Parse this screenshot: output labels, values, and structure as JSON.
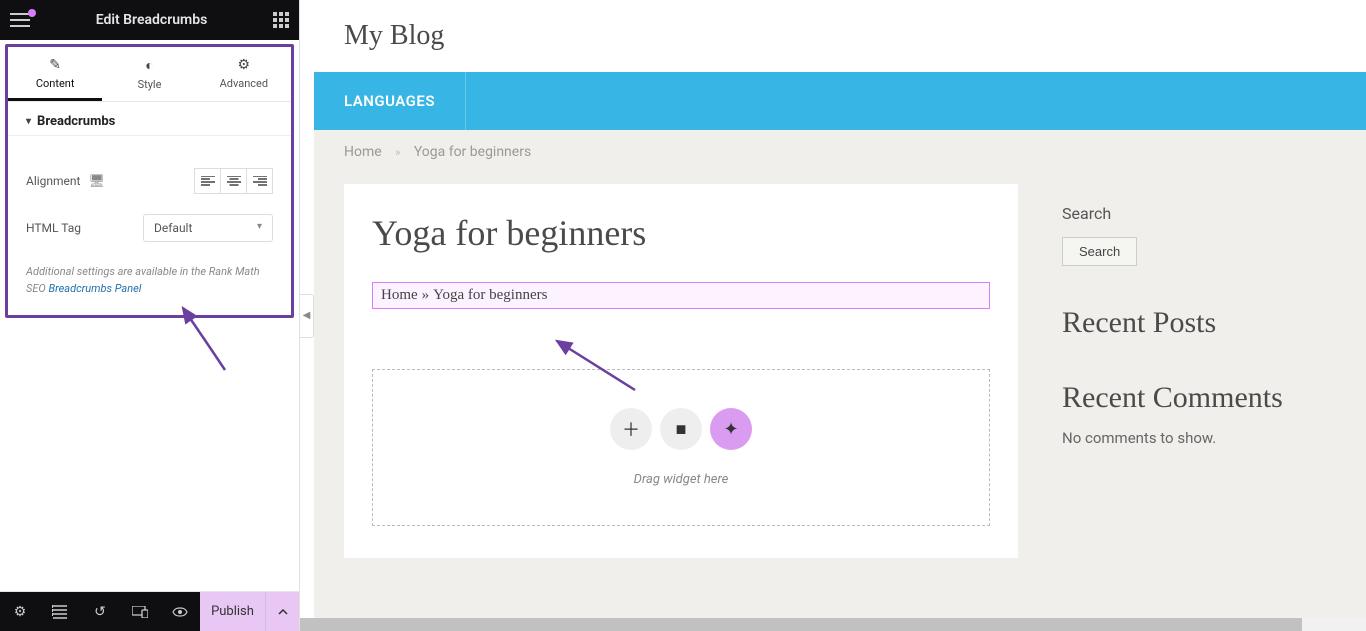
{
  "sidebar": {
    "title": "Edit Breadcrumbs",
    "tabs": {
      "content": "Content",
      "style": "Style",
      "advanced": "Advanced"
    },
    "section": "Breadcrumbs",
    "controls": {
      "alignment_label": "Alignment",
      "html_tag_label": "HTML Tag",
      "html_tag_value": "Default"
    },
    "note_prefix": "Additional settings are available in the Rank Math SEO ",
    "note_link": "Breadcrumbs Panel",
    "footer": {
      "publish": "Publish"
    }
  },
  "preview": {
    "site_title": "My Blog",
    "nav_item": "LANGUAGES",
    "breadcrumb": {
      "home": "Home",
      "sep": "»",
      "current": "Yoga for beginners"
    },
    "post_title": "Yoga for beginners",
    "widget_breadcrumb": {
      "home": "Home",
      "sep": "»",
      "current": "Yoga for beginners"
    },
    "drop_text": "Drag widget here",
    "sidebar": {
      "search_title": "Search",
      "search_btn": "Search",
      "recent_posts": "Recent Posts",
      "recent_comments": "Recent Comments",
      "no_comments": "No comments to show."
    }
  }
}
